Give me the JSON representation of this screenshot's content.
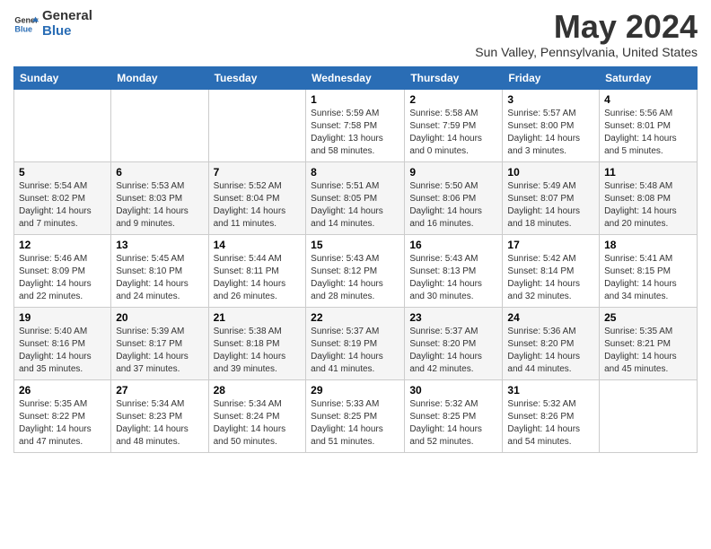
{
  "header": {
    "logo_general": "General",
    "logo_blue": "Blue",
    "month_year": "May 2024",
    "location": "Sun Valley, Pennsylvania, United States"
  },
  "weekdays": [
    "Sunday",
    "Monday",
    "Tuesday",
    "Wednesday",
    "Thursday",
    "Friday",
    "Saturday"
  ],
  "weeks": [
    [
      {
        "day": "",
        "info": ""
      },
      {
        "day": "",
        "info": ""
      },
      {
        "day": "",
        "info": ""
      },
      {
        "day": "1",
        "info": "Sunrise: 5:59 AM\nSunset: 7:58 PM\nDaylight: 13 hours and 58 minutes."
      },
      {
        "day": "2",
        "info": "Sunrise: 5:58 AM\nSunset: 7:59 PM\nDaylight: 14 hours and 0 minutes."
      },
      {
        "day": "3",
        "info": "Sunrise: 5:57 AM\nSunset: 8:00 PM\nDaylight: 14 hours and 3 minutes."
      },
      {
        "day": "4",
        "info": "Sunrise: 5:56 AM\nSunset: 8:01 PM\nDaylight: 14 hours and 5 minutes."
      }
    ],
    [
      {
        "day": "5",
        "info": "Sunrise: 5:54 AM\nSunset: 8:02 PM\nDaylight: 14 hours and 7 minutes."
      },
      {
        "day": "6",
        "info": "Sunrise: 5:53 AM\nSunset: 8:03 PM\nDaylight: 14 hours and 9 minutes."
      },
      {
        "day": "7",
        "info": "Sunrise: 5:52 AM\nSunset: 8:04 PM\nDaylight: 14 hours and 11 minutes."
      },
      {
        "day": "8",
        "info": "Sunrise: 5:51 AM\nSunset: 8:05 PM\nDaylight: 14 hours and 14 minutes."
      },
      {
        "day": "9",
        "info": "Sunrise: 5:50 AM\nSunset: 8:06 PM\nDaylight: 14 hours and 16 minutes."
      },
      {
        "day": "10",
        "info": "Sunrise: 5:49 AM\nSunset: 8:07 PM\nDaylight: 14 hours and 18 minutes."
      },
      {
        "day": "11",
        "info": "Sunrise: 5:48 AM\nSunset: 8:08 PM\nDaylight: 14 hours and 20 minutes."
      }
    ],
    [
      {
        "day": "12",
        "info": "Sunrise: 5:46 AM\nSunset: 8:09 PM\nDaylight: 14 hours and 22 minutes."
      },
      {
        "day": "13",
        "info": "Sunrise: 5:45 AM\nSunset: 8:10 PM\nDaylight: 14 hours and 24 minutes."
      },
      {
        "day": "14",
        "info": "Sunrise: 5:44 AM\nSunset: 8:11 PM\nDaylight: 14 hours and 26 minutes."
      },
      {
        "day": "15",
        "info": "Sunrise: 5:43 AM\nSunset: 8:12 PM\nDaylight: 14 hours and 28 minutes."
      },
      {
        "day": "16",
        "info": "Sunrise: 5:43 AM\nSunset: 8:13 PM\nDaylight: 14 hours and 30 minutes."
      },
      {
        "day": "17",
        "info": "Sunrise: 5:42 AM\nSunset: 8:14 PM\nDaylight: 14 hours and 32 minutes."
      },
      {
        "day": "18",
        "info": "Sunrise: 5:41 AM\nSunset: 8:15 PM\nDaylight: 14 hours and 34 minutes."
      }
    ],
    [
      {
        "day": "19",
        "info": "Sunrise: 5:40 AM\nSunset: 8:16 PM\nDaylight: 14 hours and 35 minutes."
      },
      {
        "day": "20",
        "info": "Sunrise: 5:39 AM\nSunset: 8:17 PM\nDaylight: 14 hours and 37 minutes."
      },
      {
        "day": "21",
        "info": "Sunrise: 5:38 AM\nSunset: 8:18 PM\nDaylight: 14 hours and 39 minutes."
      },
      {
        "day": "22",
        "info": "Sunrise: 5:37 AM\nSunset: 8:19 PM\nDaylight: 14 hours and 41 minutes."
      },
      {
        "day": "23",
        "info": "Sunrise: 5:37 AM\nSunset: 8:20 PM\nDaylight: 14 hours and 42 minutes."
      },
      {
        "day": "24",
        "info": "Sunrise: 5:36 AM\nSunset: 8:20 PM\nDaylight: 14 hours and 44 minutes."
      },
      {
        "day": "25",
        "info": "Sunrise: 5:35 AM\nSunset: 8:21 PM\nDaylight: 14 hours and 45 minutes."
      }
    ],
    [
      {
        "day": "26",
        "info": "Sunrise: 5:35 AM\nSunset: 8:22 PM\nDaylight: 14 hours and 47 minutes."
      },
      {
        "day": "27",
        "info": "Sunrise: 5:34 AM\nSunset: 8:23 PM\nDaylight: 14 hours and 48 minutes."
      },
      {
        "day": "28",
        "info": "Sunrise: 5:34 AM\nSunset: 8:24 PM\nDaylight: 14 hours and 50 minutes."
      },
      {
        "day": "29",
        "info": "Sunrise: 5:33 AM\nSunset: 8:25 PM\nDaylight: 14 hours and 51 minutes."
      },
      {
        "day": "30",
        "info": "Sunrise: 5:32 AM\nSunset: 8:25 PM\nDaylight: 14 hours and 52 minutes."
      },
      {
        "day": "31",
        "info": "Sunrise: 5:32 AM\nSunset: 8:26 PM\nDaylight: 14 hours and 54 minutes."
      },
      {
        "day": "",
        "info": ""
      }
    ]
  ]
}
